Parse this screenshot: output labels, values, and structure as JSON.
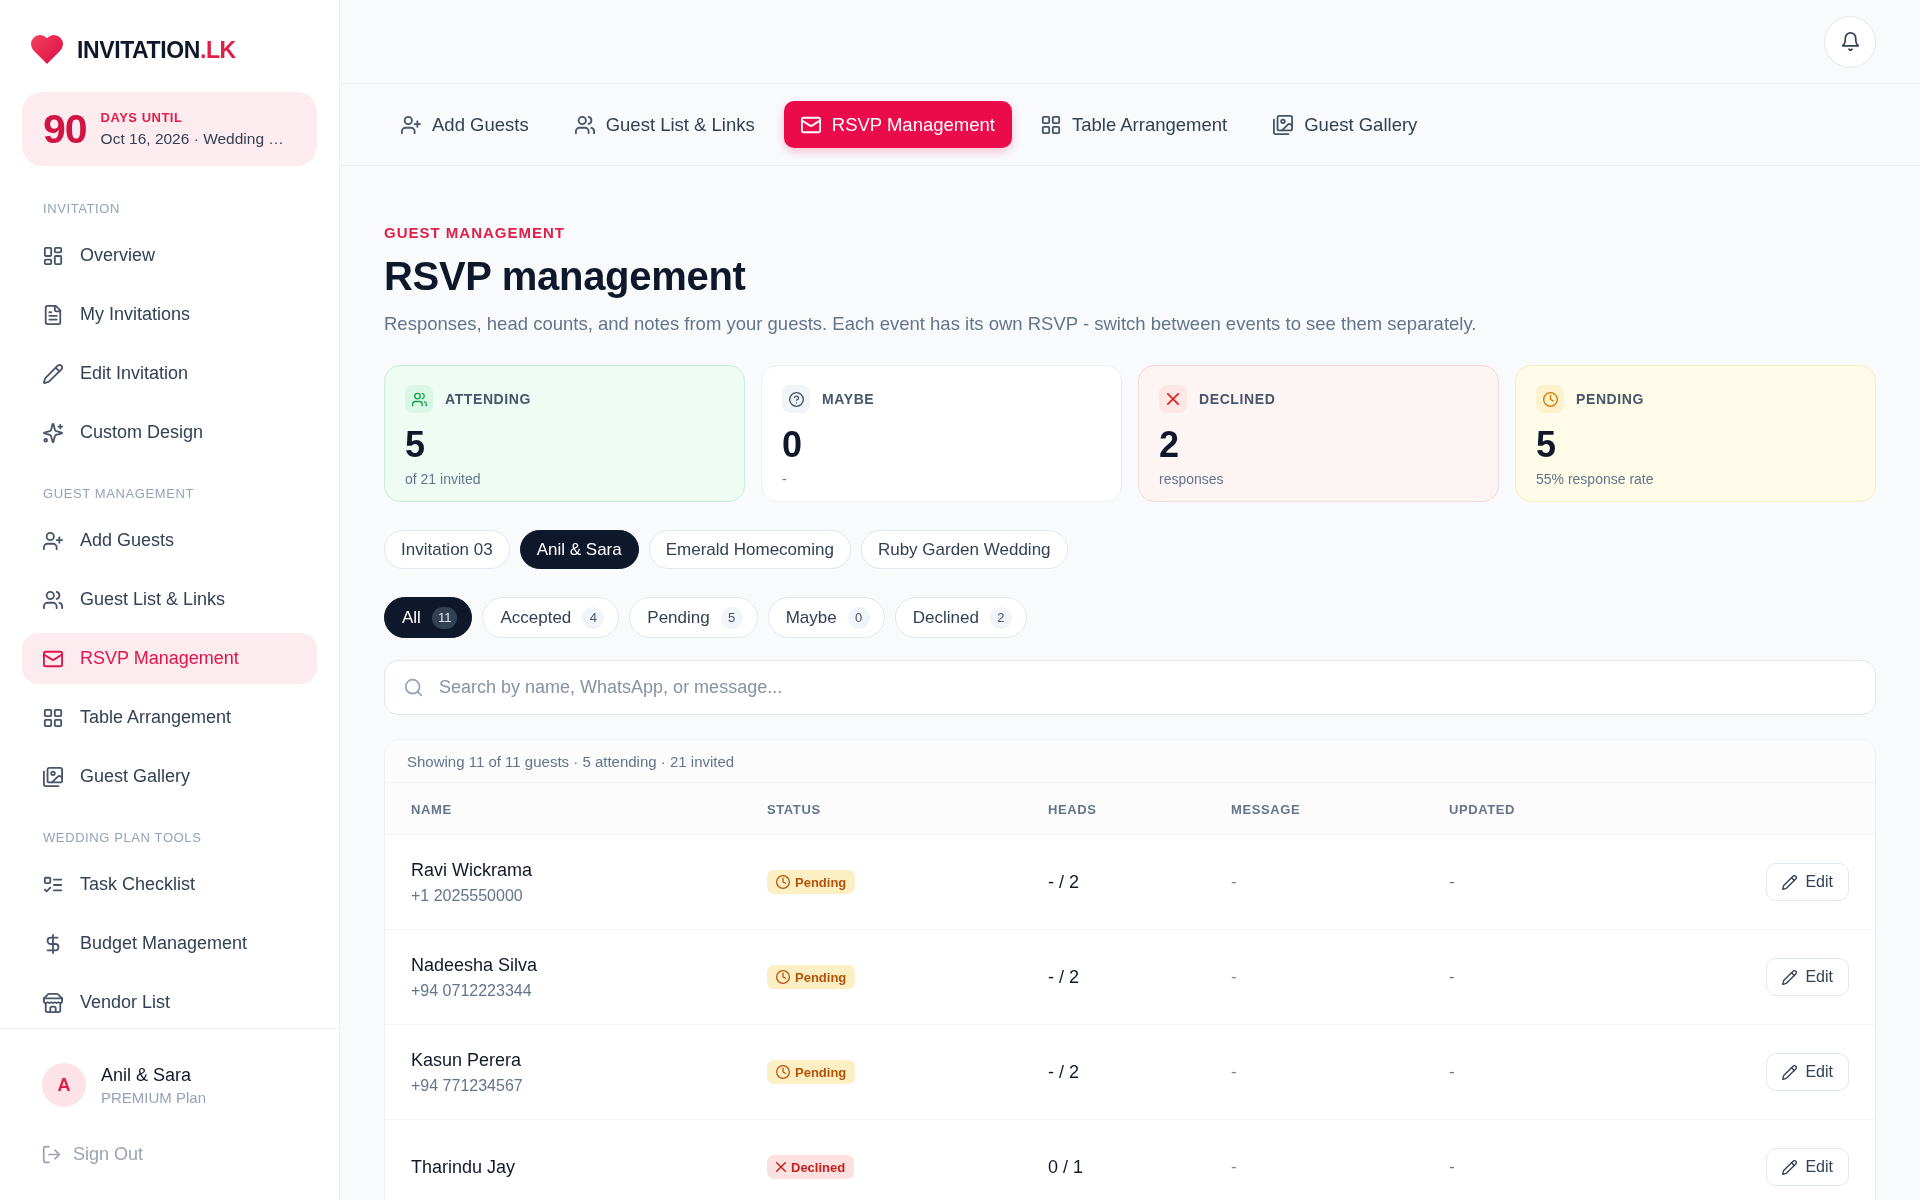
{
  "brand": {
    "name": "INVITATION",
    "suffix": ".LK"
  },
  "countdown": {
    "days": "90",
    "label": "DAYS UNTIL",
    "detail": "Oct 16, 2026 · Wedding …"
  },
  "sidebar": {
    "sections": [
      {
        "title": "INVITATION",
        "items": [
          {
            "label": "Overview",
            "selected": false
          },
          {
            "label": "My Invitations",
            "selected": false
          },
          {
            "label": "Edit Invitation",
            "selected": false
          },
          {
            "label": "Custom Design",
            "selected": false
          }
        ]
      },
      {
        "title": "GUEST MANAGEMENT",
        "items": [
          {
            "label": "Add Guests",
            "selected": false
          },
          {
            "label": "Guest List & Links",
            "selected": false
          },
          {
            "label": "RSVP Management",
            "selected": true
          },
          {
            "label": "Table Arrangement",
            "selected": false
          },
          {
            "label": "Guest Gallery",
            "selected": false
          }
        ]
      },
      {
        "title": "WEDDING PLAN TOOLS",
        "items": [
          {
            "label": "Task Checklist",
            "selected": false
          },
          {
            "label": "Budget Management",
            "selected": false
          },
          {
            "label": "Vendor List",
            "selected": false
          }
        ]
      }
    ]
  },
  "user": {
    "initial": "A",
    "name": "Anil & Sara",
    "plan": "PREMIUM Plan"
  },
  "sign_out": {
    "label": "Sign Out"
  },
  "tabs": [
    {
      "label": "Add Guests",
      "selected": false
    },
    {
      "label": "Guest List & Links",
      "selected": false
    },
    {
      "label": "RSVP Management",
      "selected": true
    },
    {
      "label": "Table Arrangement",
      "selected": false
    },
    {
      "label": "Guest Gallery",
      "selected": false
    }
  ],
  "page": {
    "eyebrow": "GUEST MANAGEMENT",
    "title": "RSVP management",
    "subtitle": "Responses, head counts, and notes from your guests. Each event has its own RSVP - switch between events to see them separately."
  },
  "stats": [
    {
      "kind": "attending",
      "label": "ATTENDING",
      "value": "5",
      "note": "of 21 invited"
    },
    {
      "kind": "maybe",
      "label": "MAYBE",
      "value": "0",
      "note": "-"
    },
    {
      "kind": "declined",
      "label": "DECLINED",
      "value": "2",
      "note": "responses"
    },
    {
      "kind": "pending",
      "label": "PENDING",
      "value": "5",
      "note": "55% response rate"
    }
  ],
  "events": [
    {
      "label": "Invitation 03",
      "selected": false
    },
    {
      "label": "Anil & Sara",
      "selected": true
    },
    {
      "label": "Emerald Homecoming",
      "selected": false
    },
    {
      "label": "Ruby Garden Wedding",
      "selected": false
    }
  ],
  "filters": [
    {
      "label": "All",
      "count": "11",
      "selected": true
    },
    {
      "label": "Accepted",
      "count": "4",
      "selected": false
    },
    {
      "label": "Pending",
      "count": "5",
      "selected": false
    },
    {
      "label": "Maybe",
      "count": "0",
      "selected": false
    },
    {
      "label": "Declined",
      "count": "2",
      "selected": false
    }
  ],
  "search": {
    "placeholder": "Search by name, WhatsApp, or message..."
  },
  "table": {
    "summary": "Showing 11 of 11 guests · 5 attending · 21 invited",
    "columns": [
      "NAME",
      "STATUS",
      "HEADS",
      "MESSAGE",
      "UPDATED"
    ],
    "rows": [
      {
        "name": "Ravi Wickrama",
        "phone": "+1 2025550000",
        "status": {
          "kind": "pending",
          "label": "Pending"
        },
        "heads": "- / 2",
        "message": "-",
        "updated": "-",
        "action": "Edit"
      },
      {
        "name": "Nadeesha Silva",
        "phone": "+94 0712223344",
        "status": {
          "kind": "pending",
          "label": "Pending"
        },
        "heads": "- / 2",
        "message": "-",
        "updated": "-",
        "action": "Edit"
      },
      {
        "name": "Kasun Perera",
        "phone": "+94 771234567",
        "status": {
          "kind": "pending",
          "label": "Pending"
        },
        "heads": "- / 2",
        "message": "-",
        "updated": "-",
        "action": "Edit"
      },
      {
        "name": "Tharindu Jay",
        "status": {
          "kind": "declined",
          "label": "Declined"
        },
        "heads": "0 / 1",
        "message": "-",
        "updated": "-",
        "action": "Edit"
      }
    ]
  }
}
